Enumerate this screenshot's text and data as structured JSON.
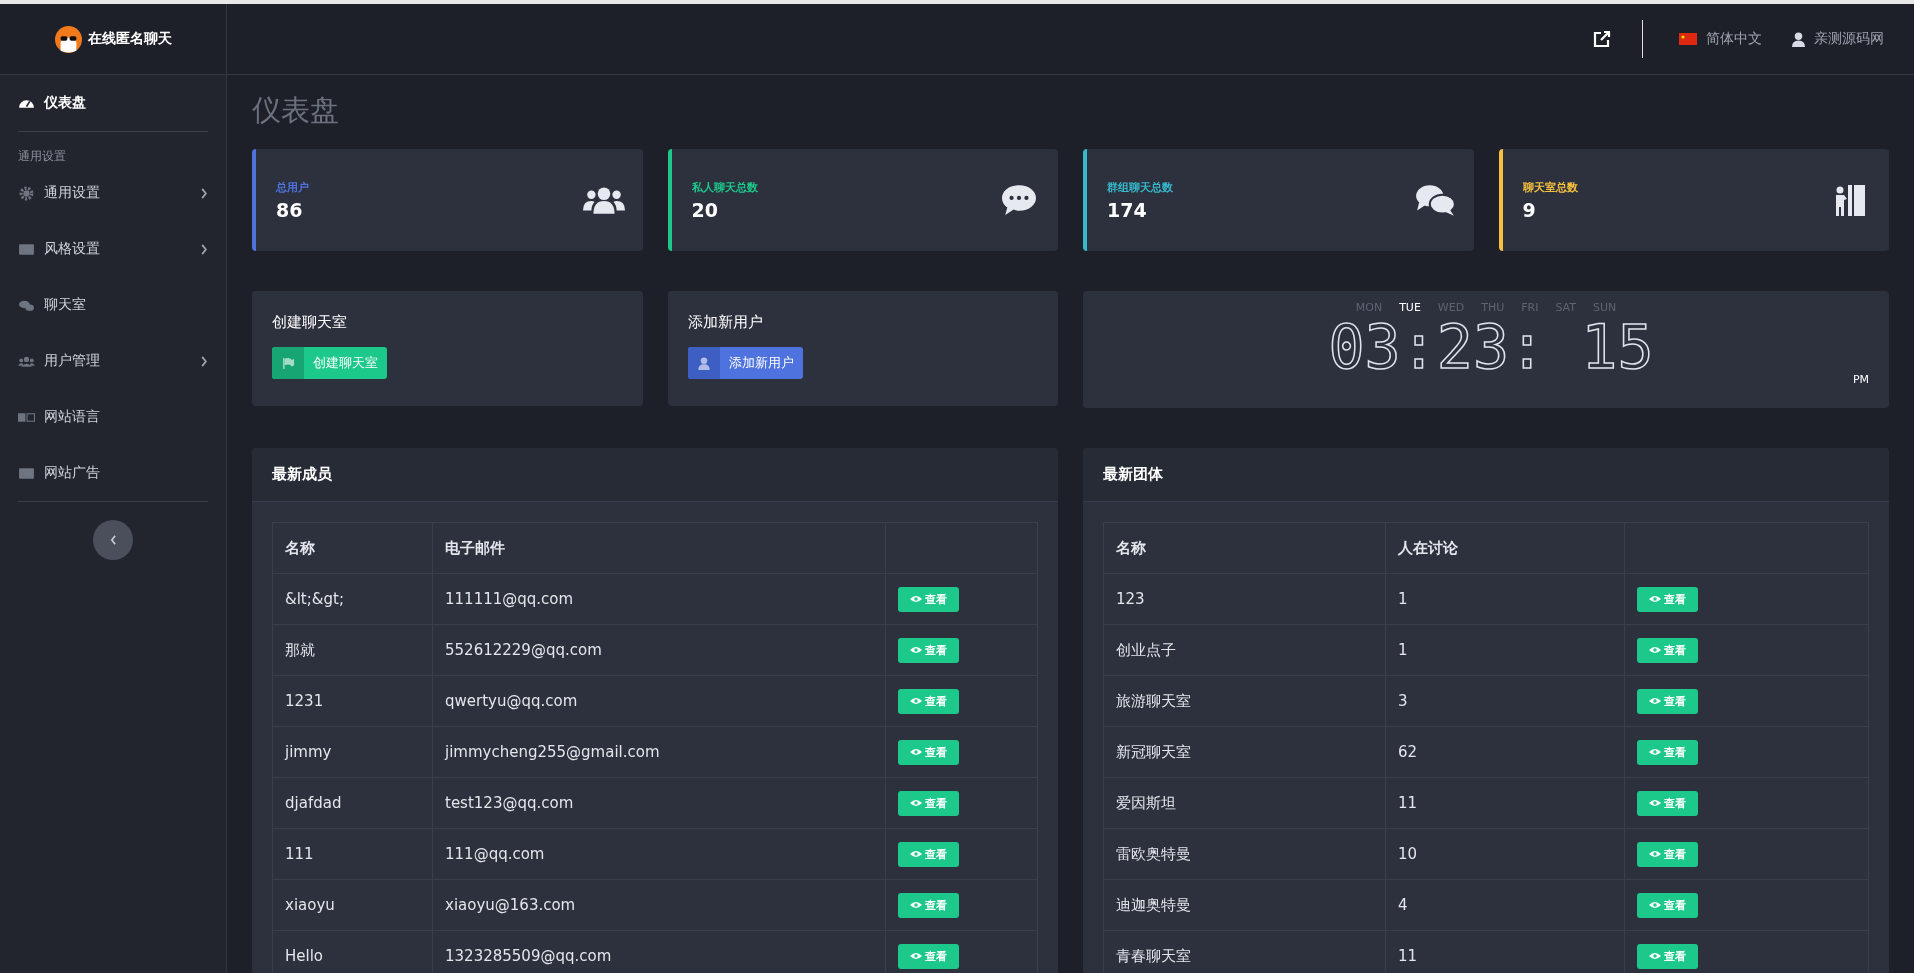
{
  "brand": {
    "title": "在线匿名聊天"
  },
  "header": {
    "language": "简体中文",
    "user": "亲测源码网"
  },
  "sidebar": {
    "items": [
      {
        "kind": "link",
        "label": "仪表盘",
        "selected": true,
        "submenu": false
      },
      {
        "kind": "section",
        "label": "通用设置"
      },
      {
        "kind": "link",
        "label": "通用设置",
        "selected": false,
        "submenu": true
      },
      {
        "kind": "link",
        "label": "风格设置",
        "selected": false,
        "submenu": true
      },
      {
        "kind": "link",
        "label": "聊天室",
        "selected": false,
        "submenu": false
      },
      {
        "kind": "link",
        "label": "用户管理",
        "selected": false,
        "submenu": true
      },
      {
        "kind": "link",
        "label": "网站语言",
        "selected": false,
        "submenu": false
      },
      {
        "kind": "link",
        "label": "网站广告",
        "selected": false,
        "submenu": false
      }
    ]
  },
  "page_title": "仪表盘",
  "stats": [
    {
      "label": "总用户",
      "value": "86",
      "color": "#4e73df"
    },
    {
      "label": "私人聊天总数",
      "value": "20",
      "color": "#1cc88a"
    },
    {
      "label": "群组聊天总数",
      "value": "174",
      "color": "#36b9cc"
    },
    {
      "label": "聊天室总数",
      "value": "9",
      "color": "#f6c23e"
    }
  ],
  "actions": [
    {
      "title": "创建聊天室",
      "button": "创建聊天室",
      "kind": "flag"
    },
    {
      "title": "添加新用户",
      "button": "添加新用户",
      "kind": "user"
    }
  ],
  "clock": {
    "days": [
      {
        "label": "MON",
        "selected": false
      },
      {
        "label": "TUE",
        "selected": true
      },
      {
        "label": "WED",
        "selected": false
      },
      {
        "label": "THU",
        "selected": false
      },
      {
        "label": "FRI",
        "selected": false
      },
      {
        "label": "SAT",
        "selected": false
      },
      {
        "label": "SUN",
        "selected": false
      }
    ],
    "time": "03:23: 15",
    "period": "PM"
  },
  "tables": [
    {
      "title": "最新成员",
      "columns": [
        "名称",
        "电子邮件"
      ],
      "rows": [
        {
          "cells": [
            "&lt;&gt;",
            "111111@qq.com"
          ],
          "action": "查看"
        },
        {
          "cells": [
            "那就",
            "552612229@qq.com"
          ],
          "action": "查看"
        },
        {
          "cells": [
            "1231",
            "qwertyu@qq.com"
          ],
          "action": "查看"
        },
        {
          "cells": [
            "jimmy",
            "jimmycheng255@gmail.com"
          ],
          "action": "查看"
        },
        {
          "cells": [
            "djafdad",
            "test123@qq.com"
          ],
          "action": "查看"
        },
        {
          "cells": [
            "111",
            "111@qq.com"
          ],
          "action": "查看"
        },
        {
          "cells": [
            "xiaoyu",
            "xiaoyu@163.com"
          ],
          "action": "查看"
        },
        {
          "cells": [
            "Hello",
            "1323285509@qq.com"
          ],
          "action": "查看"
        }
      ]
    },
    {
      "title": "最新团体",
      "columns": [
        "名称",
        "人在讨论"
      ],
      "rows": [
        {
          "cells": [
            "123",
            "1"
          ],
          "action": "查看"
        },
        {
          "cells": [
            "创业点子",
            "1"
          ],
          "action": "查看"
        },
        {
          "cells": [
            "旅游聊天室",
            "3"
          ],
          "action": "查看"
        },
        {
          "cells": [
            "新冠聊天室",
            "62"
          ],
          "action": "查看"
        },
        {
          "cells": [
            "爱因斯坦",
            "11"
          ],
          "action": "查看"
        },
        {
          "cells": [
            "雷欧奥特曼",
            "10"
          ],
          "action": "查看"
        },
        {
          "cells": [
            "迪迦奥特曼",
            "4"
          ],
          "action": "查看"
        },
        {
          "cells": [
            "青春聊天室",
            "11"
          ],
          "action": "查看"
        }
      ]
    }
  ]
}
